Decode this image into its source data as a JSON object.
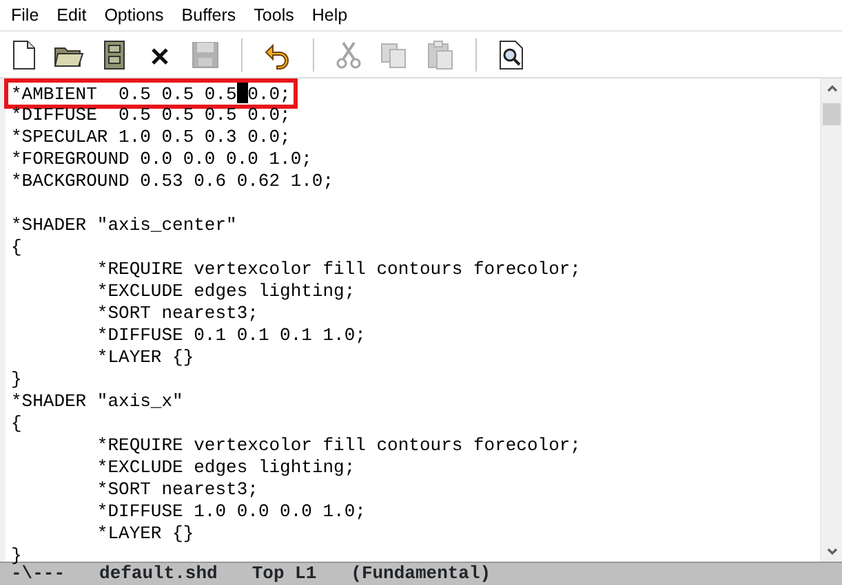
{
  "menu": [
    "File",
    "Edit",
    "Options",
    "Buffers",
    "Tools",
    "Help"
  ],
  "toolbar": [
    {
      "kind": "button",
      "disabled": false
    },
    {
      "kind": "button",
      "disabled": false
    },
    {
      "kind": "button",
      "disabled": false
    },
    {
      "kind": "button",
      "disabled": false
    },
    {
      "kind": "button",
      "disabled": true
    },
    {
      "kind": "separator"
    },
    {
      "kind": "button",
      "disabled": false
    },
    {
      "kind": "separator"
    },
    {
      "kind": "button",
      "disabled": true
    },
    {
      "kind": "button",
      "disabled": true
    },
    {
      "kind": "button",
      "disabled": true
    },
    {
      "kind": "separator"
    },
    {
      "kind": "button",
      "disabled": false
    }
  ],
  "editor": {
    "lines": [
      {
        "kind": "cursor",
        "before": "*AMBIENT  0.5 0.5 0.5",
        "after": "0.0;",
        "highlighted": true
      },
      {
        "text": "*DIFFUSE  0.5 0.5 0.5 0.0;"
      },
      {
        "text": "*SPECULAR 1.0 0.5 0.3 0.0;"
      },
      {
        "text": "*FOREGROUND 0.0 0.0 0.0 1.0;"
      },
      {
        "text": "*BACKGROUND 0.53 0.6 0.62 1.0;"
      },
      {
        "kind": "blank"
      },
      {
        "text": "*SHADER \"axis_center\""
      },
      {
        "text": "{"
      },
      {
        "text": "\t*REQUIRE vertexcolor fill contours forecolor;"
      },
      {
        "text": "\t*EXCLUDE edges lighting;"
      },
      {
        "text": "\t*SORT nearest3;"
      },
      {
        "text": "\t*DIFFUSE 0.1 0.1 0.1 1.0;"
      },
      {
        "text": "\t*LAYER {}"
      },
      {
        "text": "}"
      },
      {
        "text": "*SHADER \"axis_x\""
      },
      {
        "text": "{"
      },
      {
        "text": "\t*REQUIRE vertexcolor fill contours forecolor;"
      },
      {
        "text": "\t*EXCLUDE edges lighting;"
      },
      {
        "text": "\t*SORT nearest3;"
      },
      {
        "text": "\t*DIFFUSE 1.0 0.0 0.0 1.0;"
      },
      {
        "text": "\t*LAYER {}"
      },
      {
        "text": "}"
      }
    ]
  },
  "mode_line": {
    "status": "-\\---",
    "buffer": "default.shd",
    "position": "Top L1",
    "mode": "(Fundamental)"
  }
}
